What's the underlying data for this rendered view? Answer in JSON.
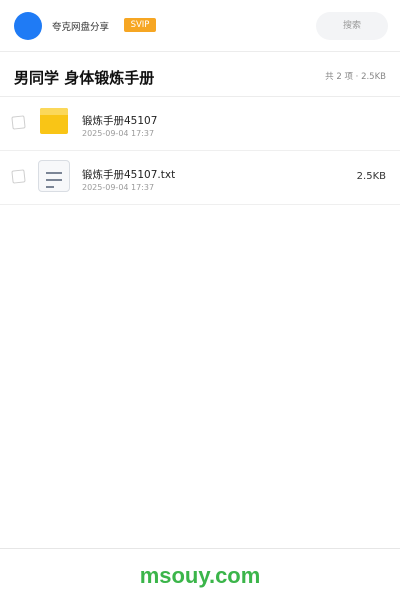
{
  "header": {
    "brand": "夸克网盘分享",
    "badge": "SVIP",
    "search_placeholder": "搜索"
  },
  "share": {
    "title": "男同学 身体锻炼手册",
    "summary": "共 2 项 · 2.5KB"
  },
  "files": [
    {
      "name": "锻炼手册45107",
      "date": "2025-09-04 17:37",
      "size": "",
      "icon": "folder-icon"
    },
    {
      "name": "锻炼手册45107.txt",
      "date": "2025-09-04 17:37",
      "size": "2.5KB",
      "icon": "text-file-icon"
    }
  ],
  "footer": {
    "watermark": "msouy.com"
  },
  "colors": {
    "accent": "#1f7bf5",
    "badge": "#f6a623",
    "folder": "#f9c516",
    "watermark": "#3bb54a"
  }
}
